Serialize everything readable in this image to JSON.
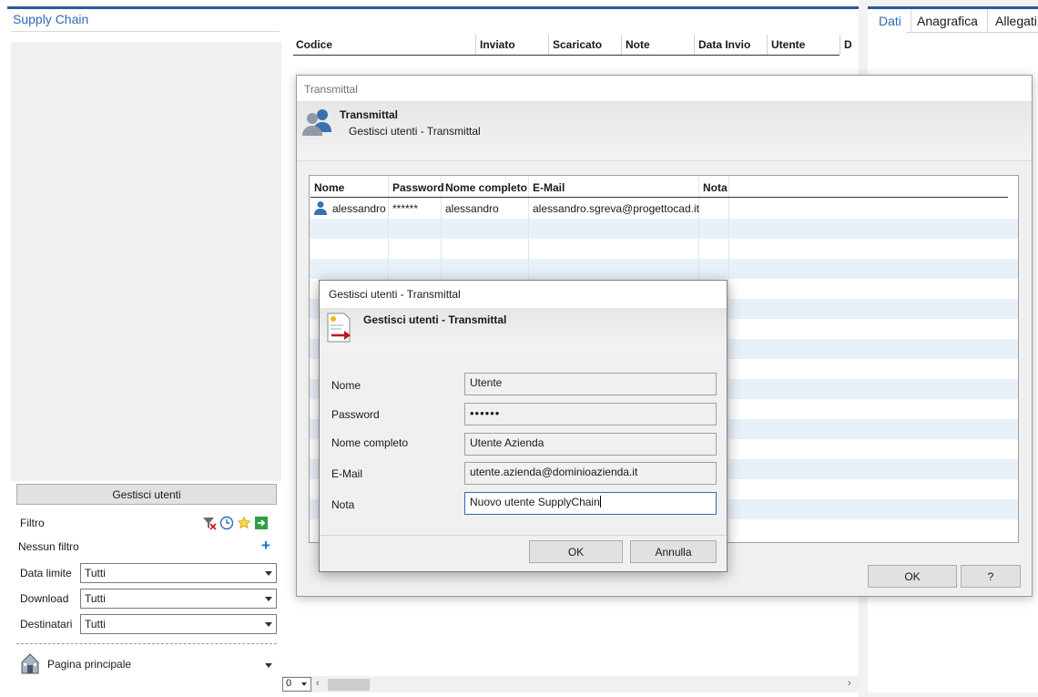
{
  "app": {
    "title": "Supply Chain"
  },
  "left_panel": {
    "manage_button": "Gestisci utenti",
    "filter_label": "Filtro",
    "no_filter_label": "Nessun filtro",
    "fields": [
      {
        "label": "Data limite",
        "value": "Tutti"
      },
      {
        "label": "Download",
        "value": "Tutti"
      },
      {
        "label": "Destinatari",
        "value": "Tutti"
      }
    ],
    "nav": {
      "label": "Pagina principale"
    }
  },
  "main_grid": {
    "columns": [
      "Codice",
      "Inviato",
      "Scaricato",
      "Note",
      "Data Invio",
      "Utente",
      "D"
    ]
  },
  "bottom_bar": {
    "zoom_value": "0"
  },
  "right_panel": {
    "tabs": [
      "Dati",
      "Anagrafica",
      "Allegati"
    ]
  },
  "transmittal_dialog": {
    "window_title": "Transmittal",
    "header_title": "Transmittal",
    "header_subtitle": "Gestisci utenti - Transmittal",
    "columns": [
      "Nome",
      "Password",
      "Nome completo",
      "E-Mail",
      "Nota"
    ],
    "rows": [
      {
        "nome": "alessandro",
        "password": "******",
        "nome_completo": "alessandro",
        "email": "alessandro.sgreva@progettocad.it",
        "nota": ""
      }
    ],
    "ok_button": "OK",
    "help_button": "?"
  },
  "user_dialog": {
    "window_title": "Gestisci utenti - Transmittal",
    "header_title": "Gestisci utenti - Transmittal",
    "fields": {
      "nome": {
        "label": "Nome",
        "value": "Utente"
      },
      "password": {
        "label": "Password",
        "value": "••••••"
      },
      "nome_completo": {
        "label": "Nome completo",
        "value": "Utente Azienda"
      },
      "email": {
        "label": "E-Mail",
        "value": "utente.azienda@dominioazienda.it"
      },
      "nota": {
        "label": "Nota",
        "value": "Nuovo utente SupplyChain"
      }
    },
    "ok_button": "OK",
    "cancel_button": "Annulla"
  },
  "colors": {
    "accent": "#2b579a",
    "link": "#2b6cb8",
    "row_alt": "#e8f0fa"
  }
}
